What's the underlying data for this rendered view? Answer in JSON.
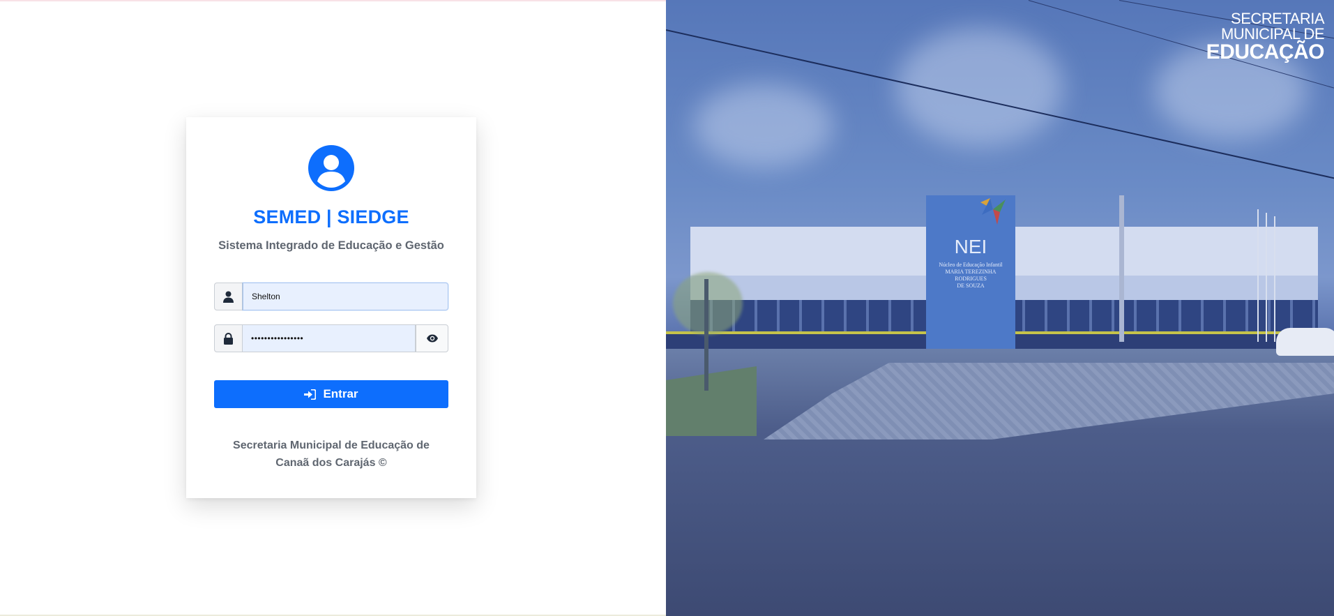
{
  "login": {
    "title": "SEMED | SIEDGE",
    "subtitle": "Sistema Integrado de Educação e Gestão",
    "username_value": "Shelton",
    "password_masked": "••••••••••••••••",
    "submit_label": "Entrar",
    "footer_line1": "Secretaria Municipal de Educação de",
    "footer_line2": "Canaã dos Carajás ©"
  },
  "photo": {
    "building_sign": "NEI",
    "building_subtext_1": "Núcleo de Educação Infantil",
    "building_subtext_2": "MARIA TEREZINHA RODRIGUES",
    "building_subtext_3": "DE SOUZA"
  },
  "brand_mark": {
    "line1": "SECRETARIA",
    "line2": "MUNICIPAL DE",
    "line3": "EDUCAÇÃO"
  },
  "icons": {
    "avatar": "user-circle-icon",
    "username": "user-icon",
    "password": "lock-icon",
    "toggle": "eye-icon",
    "submit": "sign-in-icon"
  },
  "colors": {
    "primary": "#0d6efd",
    "muted_text": "#5f6670",
    "autofill_bg": "#e8f0fe",
    "photo_overlay": "#5677b9"
  }
}
